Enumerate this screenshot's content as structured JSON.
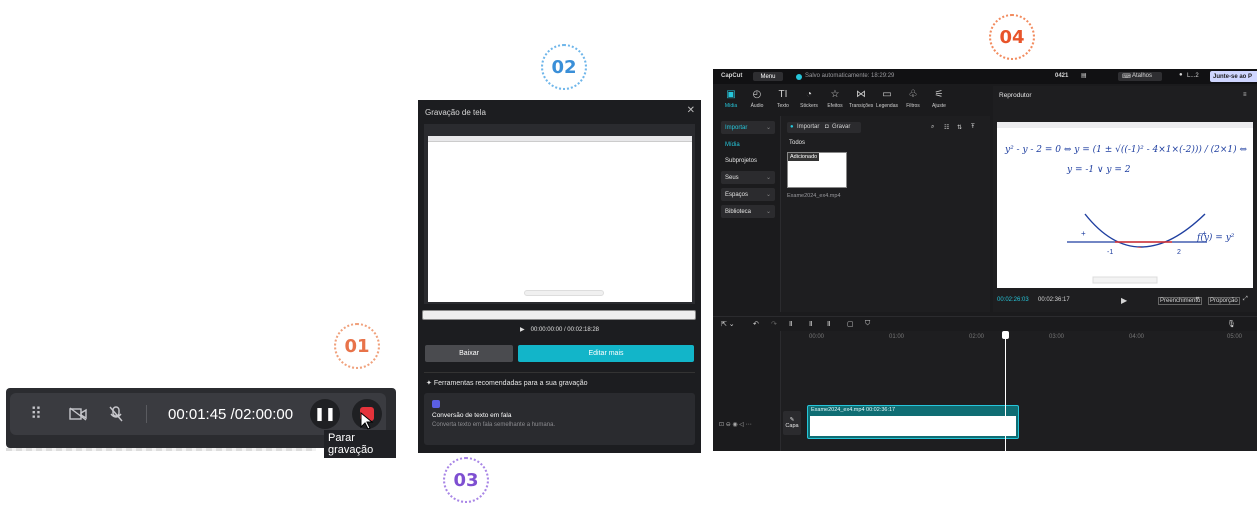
{
  "badges": {
    "b01": "01",
    "b02": "02",
    "b03": "03",
    "b04": "04"
  },
  "recording_bar": {
    "time": "00:01:45 /02:00:00",
    "stop_tooltip": "Parar gravação",
    "icons": [
      "drag-handle-icon",
      "camera-off-icon",
      "mic-off-icon",
      "pause-icon",
      "stop-icon"
    ]
  },
  "dialog": {
    "title": "Gravação de tela",
    "close": "✕",
    "time": "00:00:00:00 / 00:02:18:28",
    "baixar": "Baixar",
    "editar": "Editar mais",
    "tools_heading": "Ferramentas recomendadas para a sua gravação",
    "tool_title": "Conversão de texto em fala",
    "tool_desc": "Converta texto em fala semelhante a humana."
  },
  "capcut": {
    "logo": "CapCut",
    "menu": "Menu",
    "saved": "Salvo automaticamente: 18:29:29",
    "project": "0421",
    "atalhos": "Atalhos",
    "user": "L...2",
    "join": "Junte-se ao P",
    "tools": [
      {
        "icon": "▣",
        "label": "Mídia"
      },
      {
        "icon": "◴",
        "label": "Áudio"
      },
      {
        "icon": "TI",
        "label": "Texto"
      },
      {
        "icon": "◔",
        "label": "Stickers"
      },
      {
        "icon": "☆",
        "label": "Efeitos"
      },
      {
        "icon": "⋈",
        "label": "Transições"
      },
      {
        "icon": "▭",
        "label": "Legendas"
      },
      {
        "icon": "♧",
        "label": "Filtros"
      },
      {
        "icon": "⚟",
        "label": "Ajuste"
      }
    ],
    "nav": {
      "importar": "Importar",
      "midia": "Mídia",
      "subprojetos": "Subprojetos",
      "seus": "Seus",
      "espacos": "Espaços",
      "biblioteca": "Biblioteca"
    },
    "media": {
      "import_btn": "Importar",
      "record_btn": "Gravar",
      "todos": "Todos",
      "badge": "Adicionado",
      "filename": "Exame2024_ex4.mp4"
    },
    "player": {
      "title": "Reprodutor",
      "current": "00:02:26:03",
      "total": "00:02:36:17",
      "fill": "Preenchimento",
      "ratio": "Proporção"
    },
    "timeline": {
      "ticks": [
        "00:00",
        "01:00",
        "02:00",
        "03:00",
        "04:00",
        "05:00"
      ],
      "clip_label": "Exame2024_ex4.mp4  00:02:36:17",
      "capa": "Capa"
    },
    "math": {
      "line1": "y² - y - 2 = 0  ⇔  y = (1 ± √((-1)² - 4×1×(-2))) / (2×1)  ⇔",
      "line2": "y = -1  ∨  y = 2",
      "func": "f(y) = y²",
      "labels": [
        "-1",
        "2",
        "+",
        "+",
        "−"
      ]
    },
    "accent": "#26c6da"
  }
}
